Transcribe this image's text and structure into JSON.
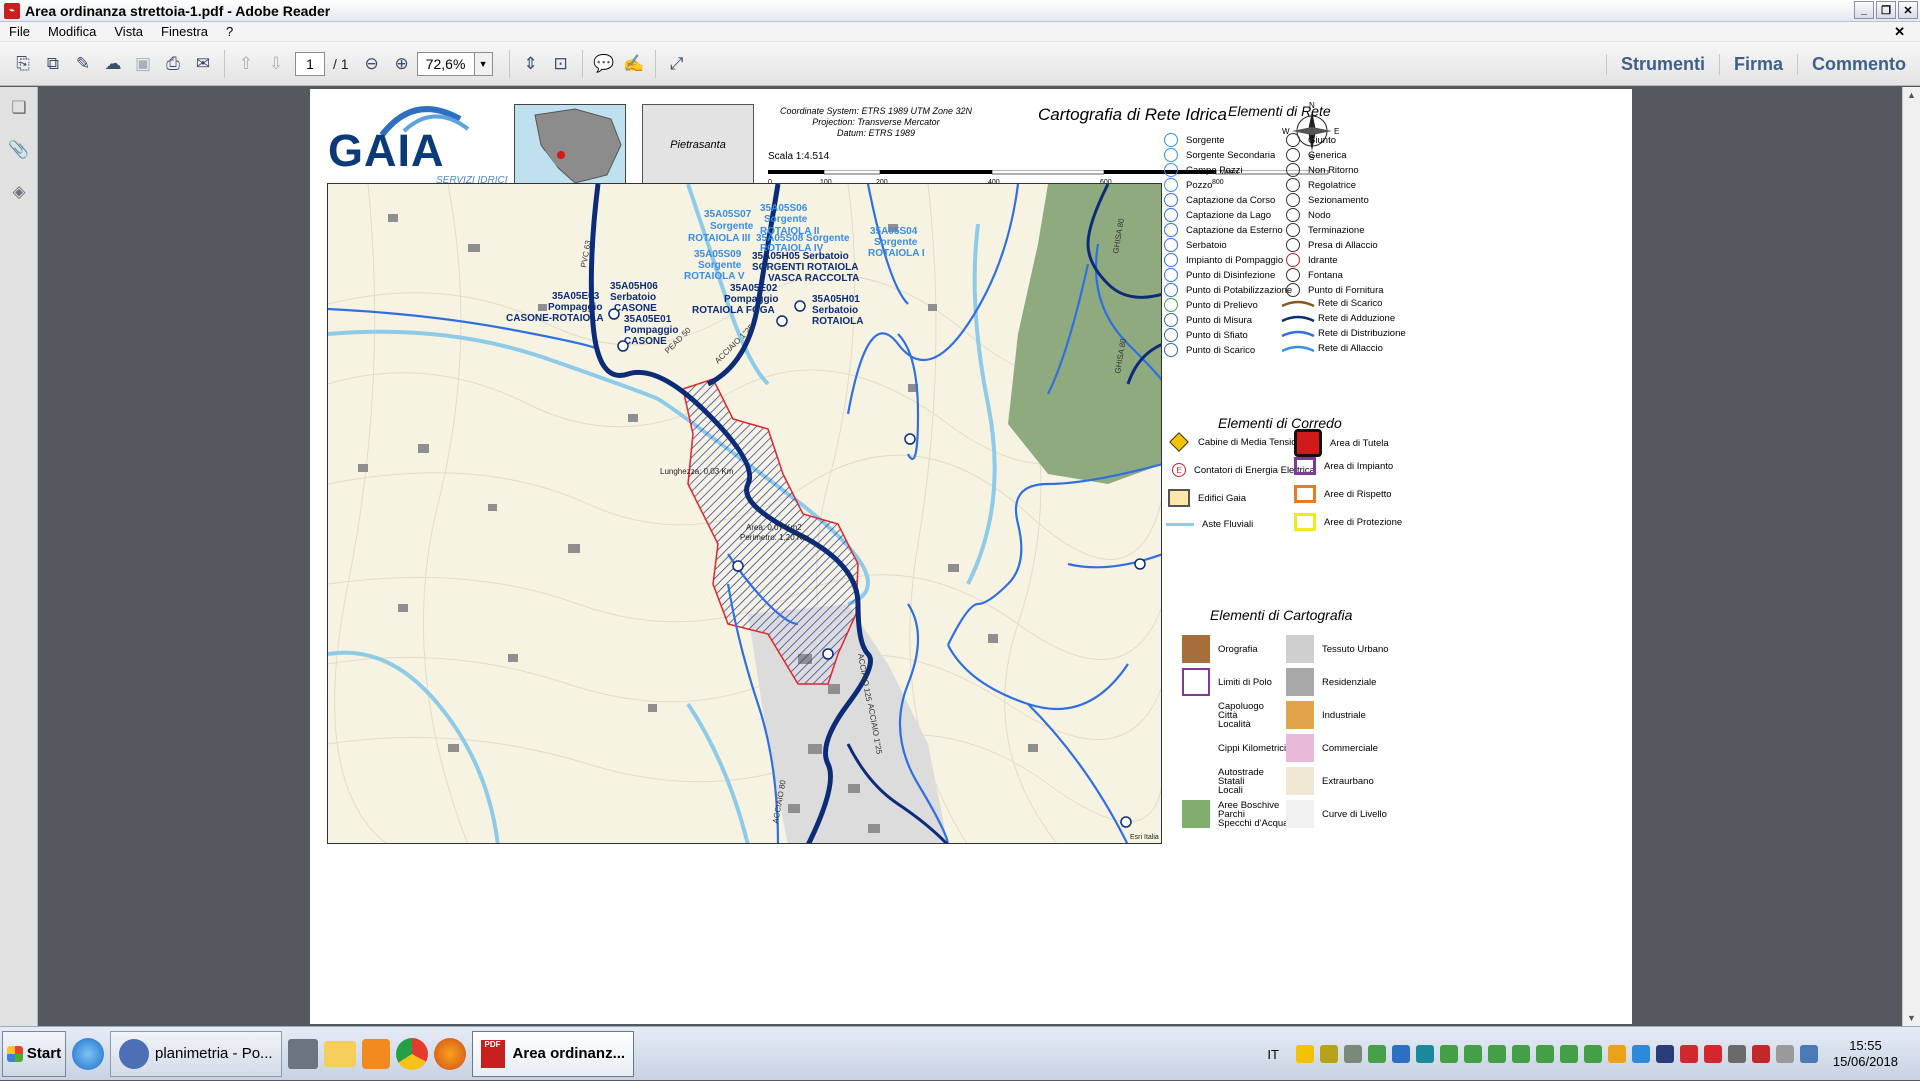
{
  "window": {
    "title": "Area ordinanza strettoia-1.pdf - Adobe Reader"
  },
  "menu": [
    "File",
    "Modifica",
    "Vista",
    "Finestra",
    "?"
  ],
  "toolbar": {
    "page": "1",
    "page_total": "/ 1",
    "zoom": "72,6%"
  },
  "right_links": [
    "Strumenti",
    "Firma",
    "Commento"
  ],
  "doc": {
    "logo": "GAIA",
    "logo_sub": "SERVIZI IDRICI",
    "town": "Pietrasanta",
    "coord_system": "Coordinate System: ETRS 1989 UTM Zone 32N",
    "projection": "Projection: Transverse Mercator",
    "datum": "Datum: ETRS 1989",
    "title": "Cartografia di Rete Idrica",
    "scale": "Scala 1:4.514",
    "scale_ticks": [
      "0",
      "100",
      "200",
      "400",
      "600",
      "800"
    ],
    "scale_unit": "Meters",
    "compass": {
      "n": "N",
      "s": "S",
      "e": "E",
      "w": "W"
    }
  },
  "legend": {
    "rete_title": "Elementi di Rete",
    "rete_left": [
      "Sorgente",
      "Sorgente Secondaria",
      "Campo Pozzi",
      "Pozzo",
      "Captazione da Corso",
      "Captazione da Lago",
      "Captazione da Esterno",
      "Serbatoio",
      "Impianto di Pompaggio",
      "Punto di Disinfezione",
      "Punto di Potabilizzazione",
      "Punto di Prelievo",
      "Punto di Misura",
      "Punto di Sfiato",
      "Punto di Scarico"
    ],
    "rete_right_points": [
      "Giunto",
      "Generica",
      "Non Ritorno",
      "Regolatrice",
      "Sezionamento",
      "Nodo",
      "Terminazione",
      "Presa di Allaccio",
      "Idrante",
      "Fontana",
      "Punto di Fornitura"
    ],
    "rete_right_lines": [
      "Rete di Scarico",
      "Rete di Adduzione",
      "Rete di Distribuzione",
      "Rete di Allaccio"
    ],
    "corredo_title": "Elementi di Corredo",
    "corredo_left": [
      "Cabine di Media Tensione",
      "Contatori di Energia Elettrica",
      "Edifici Gaia",
      "Aste Fluviali"
    ],
    "corredo_right": [
      "Area di Tutela",
      "Area di Impianto",
      "Aree di Rispetto",
      "Aree di Protezione"
    ],
    "carto_title": "Elementi di Cartografia",
    "carto_left": [
      "Orografia",
      "Limiti di Polo",
      "Capoluogo\nCittà\nLocalità",
      "Cippi Kilometrici",
      "Autostrade\nStatali\nLocali",
      "Aree Boschive\nParchi\nSpecchi d'Acqua"
    ],
    "carto_right": [
      "Tessuto Urbano",
      "Residenziale",
      "Industriale",
      "Commerciale",
      "Extraurbano",
      "Curve di Livello"
    ],
    "colors": {
      "scarico": "#8b5a1b",
      "adduzione": "#0c2c78",
      "distribuzione": "#2f6fe0",
      "allaccio": "#3a8de6"
    }
  },
  "map_labels": {
    "a1": "35A05S07",
    "a2": "Sorgente",
    "a3": "ROTAIOLA III",
    "b1": "35A05S06",
    "b2": "Sorgente",
    "b3": "ROTAIOLA II",
    "b4": "35A05S08 Sorgente",
    "b5": "ROTAIOLA IV",
    "c1": "35A05S04",
    "c2": "Sorgente",
    "c3": "ROTAIOLA I",
    "d1": "35A05S09",
    "d2": "Sorgente",
    "d3": "ROTAIOLA V",
    "e1": "35A05H05 Serbatoio",
    "e2": "SORGENTI ROTAIOLA",
    "e3": "VASCA RACCOLTA",
    "f1": "35A05H06",
    "f2": "Serbatoio",
    "f3": "CASONE",
    "g1": "35A05E03",
    "g2": "Pompaggio",
    "g3": "CASONE-ROTAIOLA",
    "h1": "35A05E01",
    "h2": "Pompaggio",
    "h3": "CASONE",
    "i1": "35A05E02",
    "i2": "Pompaggio",
    "i3": "ROTAIOLA FOGA",
    "j1": "35A05H01",
    "j2": "Serbatoio",
    "j3": "ROTAIOLA",
    "len": "Lunghezza: 0,03 Km",
    "area1": "Area: 0,07 Km2",
    "area2": "Perimetro: 1,20 Km",
    "pipe1": "PVC 63",
    "pipe2": "PEAD 50",
    "pipe3": "ACCIAIO 1\"25",
    "pipe4": "GHISA 80",
    "pipe5": "GHISA 80",
    "pipe6": "ACCIAIO 1\"25",
    "pipe7": "ACCIAIO 80",
    "pipe8": "ACCIAIO 125",
    "credit": "Esri Italia"
  },
  "taskbar": {
    "start": "Start",
    "items": [
      "planimetria - Po...",
      "Area ordinanz..."
    ],
    "lang": "IT",
    "time": "15:55",
    "date": "15/06/2018"
  }
}
